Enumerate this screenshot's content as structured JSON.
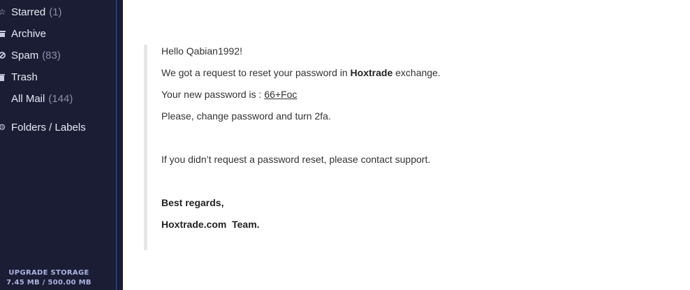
{
  "sidebar": {
    "items": [
      {
        "label": "Starred",
        "count": "(1)",
        "icon": "star-icon"
      },
      {
        "label": "Archive",
        "count": "",
        "icon": "archive-icon"
      },
      {
        "label": "Spam",
        "count": "(83)",
        "icon": "spam-icon"
      },
      {
        "label": "Trash",
        "count": "",
        "icon": "trash-icon"
      },
      {
        "label": "All Mail",
        "count": "(144)",
        "icon": ""
      },
      {
        "label": "Folders / Labels",
        "count": "",
        "icon": "gear-icon"
      }
    ],
    "storage": {
      "title": "UPGRADE STORAGE",
      "usage": "7.45 MB / 500.00 MB"
    }
  },
  "message": {
    "greeting": "Hello Qabian1992!",
    "request_pre": "We got a request to reset your password in ",
    "request_brand": "Hoxtrade",
    "request_post": " exchange.",
    "password_label": "Your new password is : ",
    "password_value": "66+Foc",
    "instruction": "Please, change password and turn 2fa.",
    "disclaimer": "If you didn’t request a password reset, please contact support.",
    "closing": "Best regards,",
    "signature": "Hoxtrade.com  Team."
  }
}
